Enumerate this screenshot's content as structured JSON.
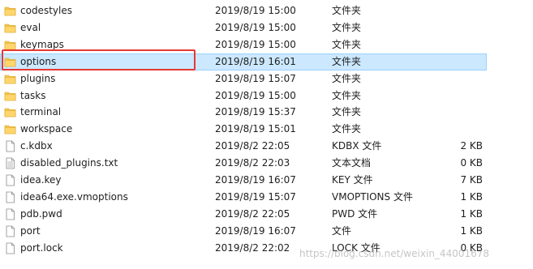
{
  "files": [
    {
      "name": "codestyles",
      "date": "2019/8/19 15:00",
      "type": "文件夹",
      "size": "",
      "icon": "folder-icon"
    },
    {
      "name": "eval",
      "date": "2019/8/19 15:00",
      "type": "文件夹",
      "size": "",
      "icon": "folder-icon"
    },
    {
      "name": "keymaps",
      "date": "2019/8/19 15:00",
      "type": "文件夹",
      "size": "",
      "icon": "folder-icon"
    },
    {
      "name": "options",
      "date": "2019/8/19 16:01",
      "type": "文件夹",
      "size": "",
      "icon": "folder-icon",
      "selected": true
    },
    {
      "name": "plugins",
      "date": "2019/8/19 15:07",
      "type": "文件夹",
      "size": "",
      "icon": "folder-icon"
    },
    {
      "name": "tasks",
      "date": "2019/8/19 15:00",
      "type": "文件夹",
      "size": "",
      "icon": "folder-icon"
    },
    {
      "name": "terminal",
      "date": "2019/8/19 15:37",
      "type": "文件夹",
      "size": "",
      "icon": "folder-icon"
    },
    {
      "name": "workspace",
      "date": "2019/8/19 15:01",
      "type": "文件夹",
      "size": "",
      "icon": "folder-icon"
    },
    {
      "name": "c.kdbx",
      "date": "2019/8/2 22:05",
      "type": "KDBX 文件",
      "size": "2 KB",
      "icon": "file-icon"
    },
    {
      "name": "disabled_plugins.txt",
      "date": "2019/8/2 22:03",
      "type": "文本文档",
      "size": "0 KB",
      "icon": "text-file-icon"
    },
    {
      "name": "idea.key",
      "date": "2019/8/19 16:07",
      "type": "KEY 文件",
      "size": "7 KB",
      "icon": "file-icon"
    },
    {
      "name": "idea64.exe.vmoptions",
      "date": "2019/8/19 15:07",
      "type": "VMOPTIONS 文件",
      "size": "1 KB",
      "icon": "file-icon"
    },
    {
      "name": "pdb.pwd",
      "date": "2019/8/2 22:05",
      "type": "PWD 文件",
      "size": "1 KB",
      "icon": "file-icon"
    },
    {
      "name": "port",
      "date": "2019/8/19 16:07",
      "type": "文件",
      "size": "1 KB",
      "icon": "file-icon"
    },
    {
      "name": "port.lock",
      "date": "2019/8/2 22:02",
      "type": "LOCK 文件",
      "size": "0 KB",
      "icon": "file-icon"
    }
  ],
  "colors": {
    "selection_bg": "#cce8ff",
    "selection_border": "#99d1ff",
    "highlight_box": "#e53935",
    "folder": "#f7c548"
  },
  "watermark": "https://blog.csdn.net/weixin_44001678"
}
